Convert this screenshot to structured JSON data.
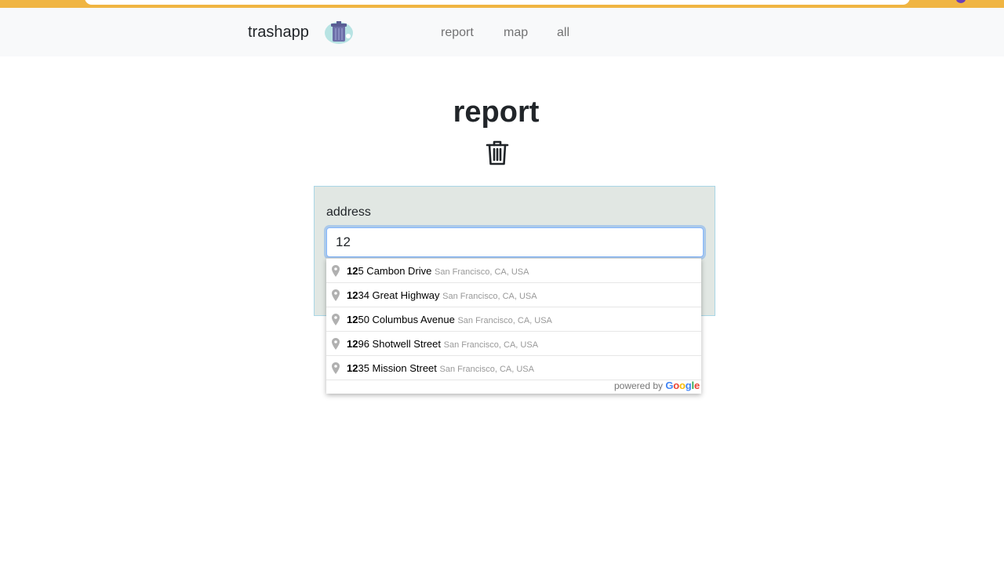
{
  "navbar": {
    "brand": "trashapp",
    "links": [
      "report",
      "map",
      "all"
    ]
  },
  "main": {
    "title": "report"
  },
  "form": {
    "address_label": "address",
    "address_value": "12"
  },
  "suggestions": [
    {
      "match": "12",
      "rest": "5 Cambon Drive",
      "secondary": "San Francisco, CA, USA"
    },
    {
      "match": "12",
      "rest": "34 Great Highway",
      "secondary": "San Francisco, CA, USA"
    },
    {
      "match": "12",
      "rest": "50 Columbus Avenue",
      "secondary": "San Francisco, CA, USA"
    },
    {
      "match": "12",
      "rest": "96 Shotwell Street",
      "secondary": "San Francisco, CA, USA"
    },
    {
      "match": "12",
      "rest": "35 Mission Street",
      "secondary": "San Francisco, CA, USA"
    }
  ],
  "attribution": {
    "powered_by": "powered by",
    "google": [
      "G",
      "o",
      "o",
      "g",
      "l",
      "e"
    ],
    "google_colors": [
      "#4285F4",
      "#EA4335",
      "#FBBC05",
      "#4285F4",
      "#34A853",
      "#EA4335"
    ]
  },
  "colors": {
    "browser_bar": "#f0b542",
    "navbar_bg": "#f8f9fa",
    "card_bg": "#e1e7e3",
    "card_border": "#a9d6e6",
    "input_focus": "#86b7fe"
  }
}
